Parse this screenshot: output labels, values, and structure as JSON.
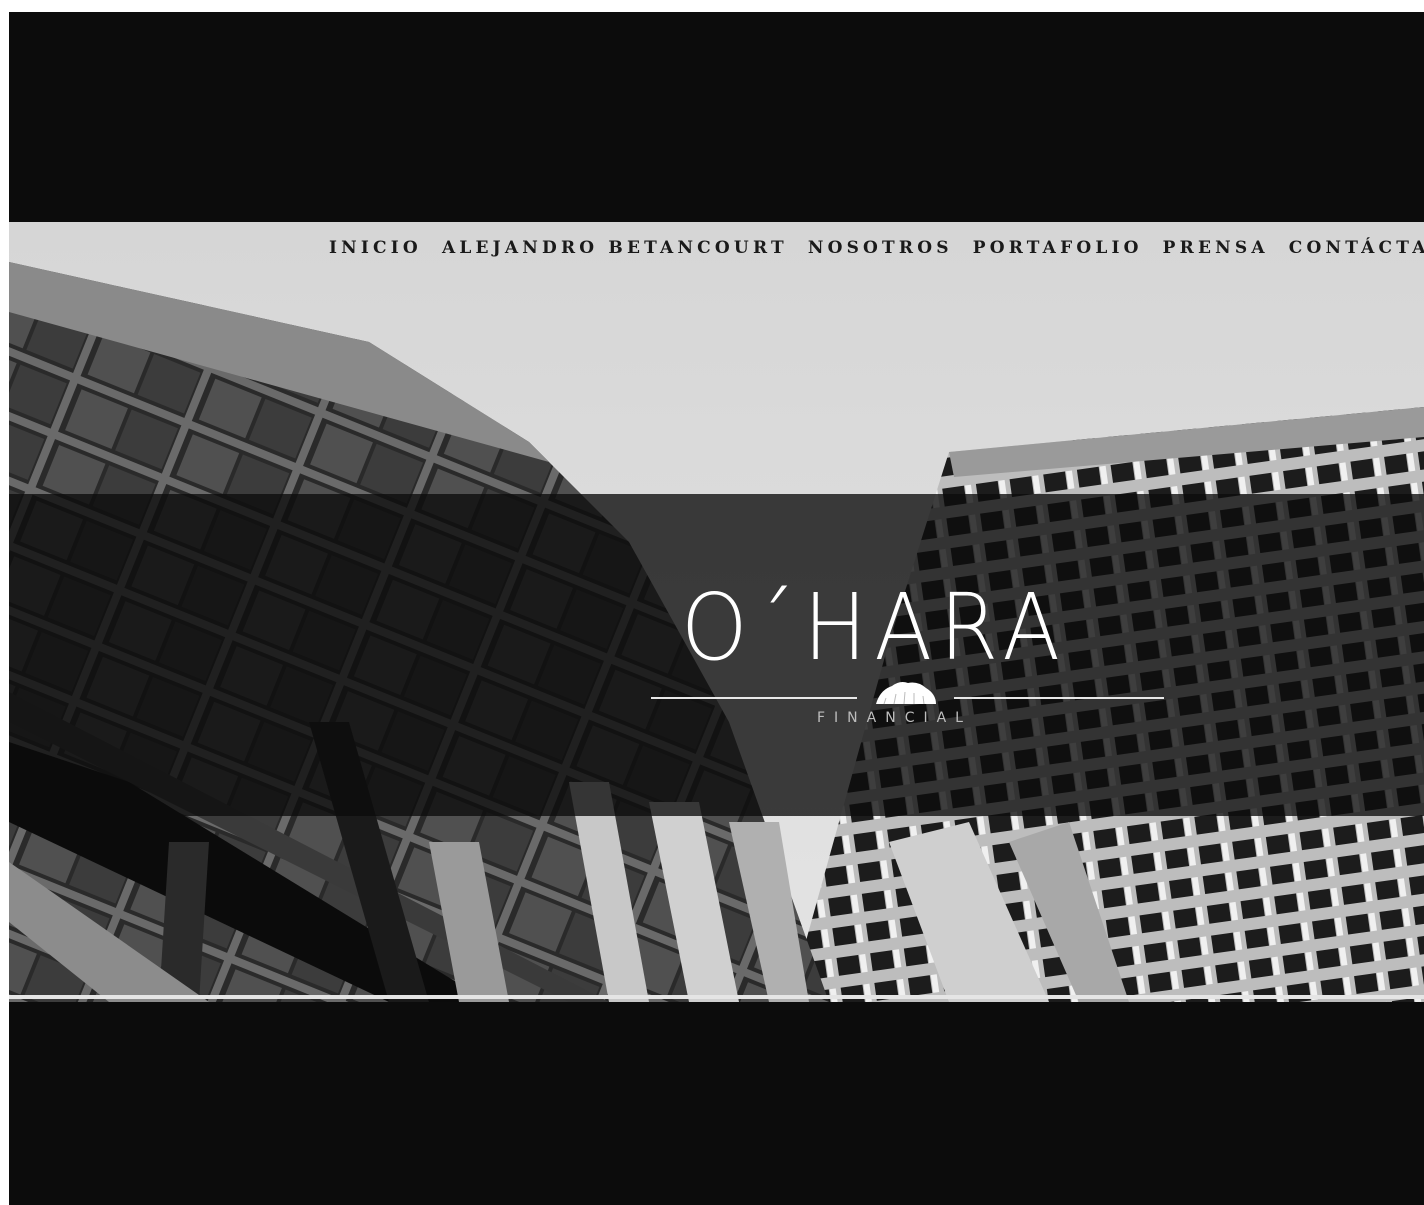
{
  "nav": {
    "items": [
      {
        "label": "INICIO"
      },
      {
        "label": "ALEJANDRO BETANCOURT"
      },
      {
        "label": "NOSOTROS"
      },
      {
        "label": "PORTAFOLIO"
      },
      {
        "label": "PRENSA"
      },
      {
        "label": "CONTÁCTA"
      }
    ]
  },
  "logo": {
    "name": "O´HARA",
    "tagline": "FINANCIAL",
    "mark_icon": "tree-crown-icon"
  },
  "hero": {
    "image": "black-and-white skyscraper facades looking up"
  },
  "colors": {
    "background": "#0c0c0c",
    "band": "#0c0c0c",
    "nav_text": "#1a1a1a",
    "logo_text": "#ffffff"
  }
}
